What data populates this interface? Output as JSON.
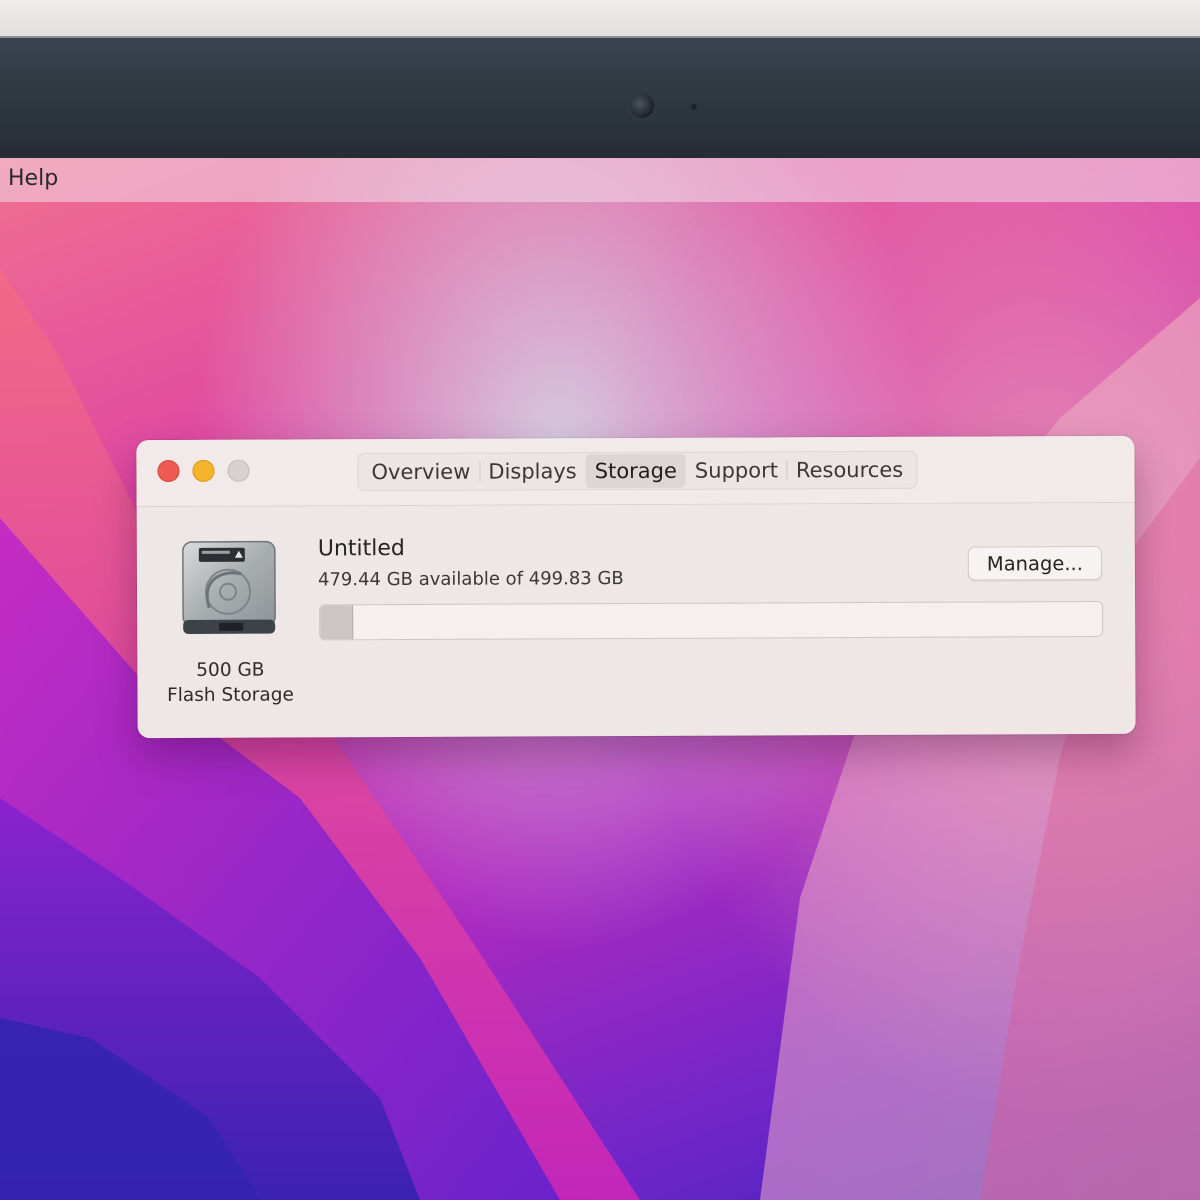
{
  "menubar": {
    "help_label": "Help"
  },
  "window": {
    "tabs": [
      {
        "label": "Overview",
        "active": false
      },
      {
        "label": "Displays",
        "active": false
      },
      {
        "label": "Storage",
        "active": true
      },
      {
        "label": "Support",
        "active": false
      },
      {
        "label": "Resources",
        "active": false
      }
    ],
    "drive": {
      "icon": "hard-drive-icon",
      "capacity_label": "500 GB",
      "type_label": "Flash Storage"
    },
    "volume": {
      "name": "Untitled",
      "available_text": "479.44 GB available of 499.83 GB",
      "available_gb": 479.44,
      "total_gb": 499.83
    },
    "manage_button_label": "Manage..."
  },
  "colors": {
    "close": "#ef5a52",
    "minimize": "#f4b42c",
    "zoom_inactive": "#d7d2d0",
    "window_bg": "#efe7e5"
  }
}
